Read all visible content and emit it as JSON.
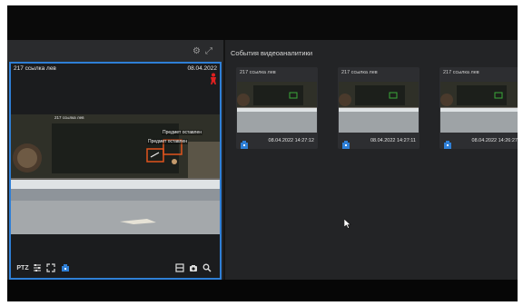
{
  "camera": {
    "title": "217 ссылка лев",
    "date": "08.04.2022",
    "labels": [
      "Предмет оставлен",
      "Предмет оставлен"
    ],
    "video_caption": "217 ссылка лев",
    "controls": {
      "ptz": "PTZ"
    }
  },
  "events": {
    "title": "События видеоаналитики",
    "items": [
      {
        "name": "217 ссылка лев",
        "time": "08.04.2022 14:27:12"
      },
      {
        "name": "217 ссылка лев",
        "time": "08.04.2022 14:27:11"
      },
      {
        "name": "217 ссылка лев",
        "time": "08.04.2022 14:26:27"
      }
    ]
  },
  "colors": {
    "accent": "#2f7fd6",
    "alarm": "#e02020",
    "detection_box": "#e0541c"
  }
}
